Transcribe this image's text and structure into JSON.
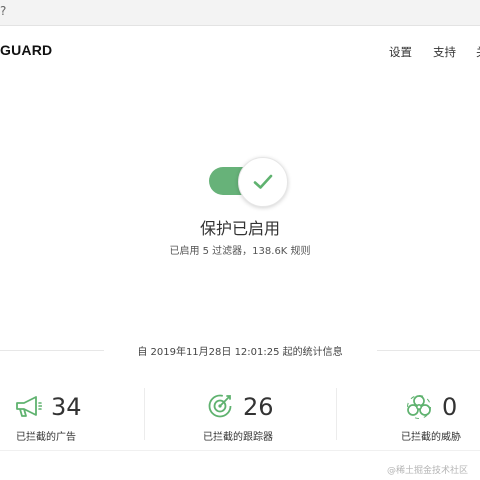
{
  "topbar": {
    "glyph": "?"
  },
  "brand": {
    "name": "GUARD"
  },
  "nav": {
    "settings": "设置",
    "support": "支持",
    "extra": "关"
  },
  "protection": {
    "title": "保护已启用",
    "subtitle": "已启用 5 过滤器，138.6K 规则",
    "enabled": true
  },
  "stats": {
    "header": "自 2019年11月28日 12:01:25 起的统计信息",
    "ads": {
      "value": "34",
      "label": "已拦截的广告",
      "icon": "megaphone-icon"
    },
    "trackers": {
      "value": "26",
      "label": "已拦截的跟踪器",
      "icon": "target-icon"
    },
    "threats": {
      "value": "0",
      "label": "已拦截的威胁",
      "icon": "biohazard-icon"
    }
  },
  "watermark": "@稀土掘金技术社区",
  "colors": {
    "accent": "#67b279",
    "icon_green": "#5fb26f"
  }
}
